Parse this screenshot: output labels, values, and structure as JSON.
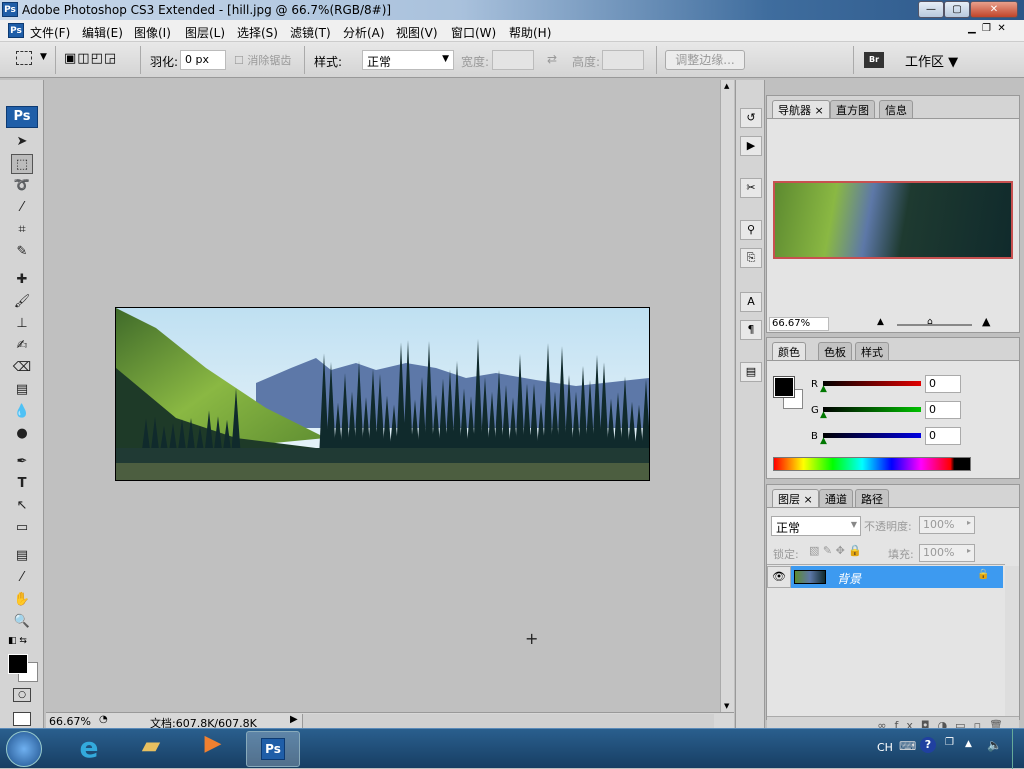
{
  "window": {
    "title": "Adobe Photoshop CS3 Extended - [hill.jpg @ 66.7%(RGB/8#)]",
    "ps_badge": "Ps"
  },
  "menu": [
    "文件(F)",
    "编辑(E)",
    "图像(I)",
    "图层(L)",
    "选择(S)",
    "滤镜(T)",
    "分析(A)",
    "视图(V)",
    "窗口(W)",
    "帮助(H)"
  ],
  "options": {
    "feather_label": "羽化:",
    "feather_value": "0 px",
    "antialias_label": "消除锯齿",
    "style_label": "样式:",
    "style_value": "正常",
    "width_label": "宽度:",
    "height_label": "高度:",
    "refine_edge": "调整边缘...",
    "workspace": "工作区 ▼",
    "bridge_label": "Br"
  },
  "status": {
    "zoom": "66.67%",
    "doc": "文档:607.8K/607.8K"
  },
  "navigator": {
    "tabs": [
      "导航器",
      "直方图",
      "信息"
    ],
    "zoom": "66.67%"
  },
  "color": {
    "tabs": [
      "颜色",
      "色板",
      "样式"
    ],
    "channels": [
      {
        "label": "R",
        "value": "0",
        "color": "#e00000"
      },
      {
        "label": "G",
        "value": "0",
        "color": "#00c000"
      },
      {
        "label": "B",
        "value": "0",
        "color": "#0000e0"
      }
    ]
  },
  "layers": {
    "tabs": [
      "图层",
      "通道",
      "路径"
    ],
    "blend": "正常",
    "opacity_label": "不透明度:",
    "opacity": "100%",
    "lock_label": "锁定:",
    "fill_label": "填充:",
    "fill": "100%",
    "layer_name": "背景"
  },
  "taskbar": {
    "lang": "CH",
    "ps": "Ps"
  }
}
